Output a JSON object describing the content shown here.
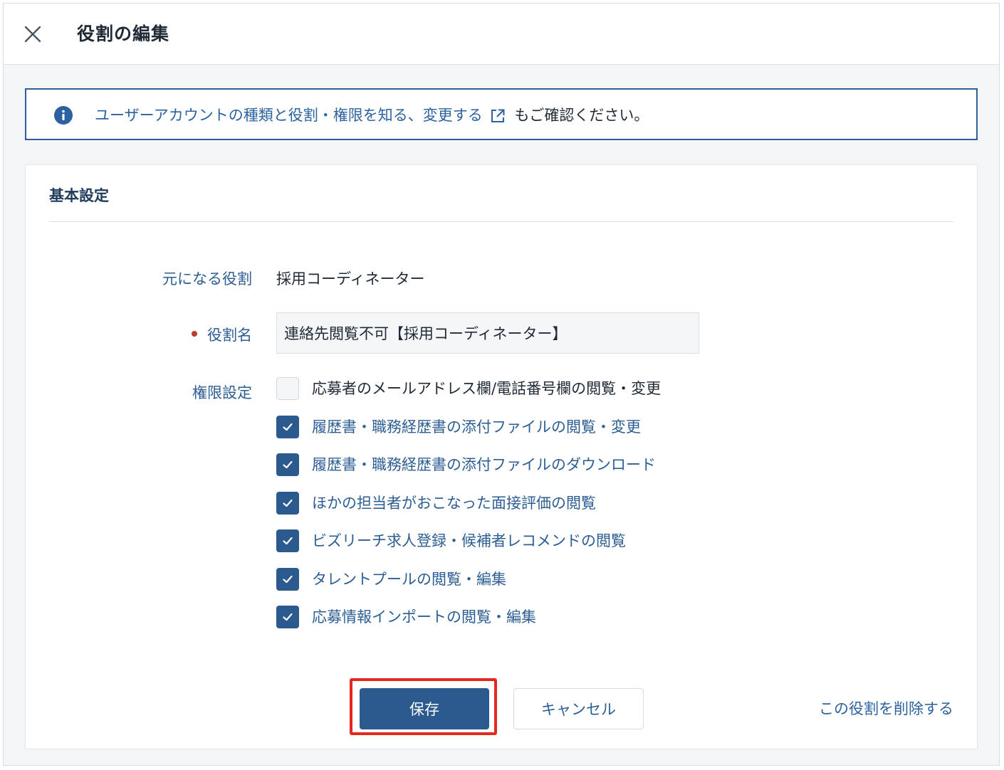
{
  "header": {
    "title": "役割の編集",
    "close_icon": "close-icon"
  },
  "notice": {
    "icon": "info-icon",
    "link_text": "ユーザーアカウントの種類と役割・権限を知る、変更する",
    "link_icon": "external-link-icon",
    "suffix_text": "もご確認ください。"
  },
  "basic_settings": {
    "section_title": "基本設定",
    "base_role_label": "元になる役割",
    "base_role_value": "採用コーディネーター",
    "role_name_label": "役割名",
    "role_name_value": "連絡先閲覧不可【採用コーディネーター】",
    "permissions_label": "権限設定",
    "permissions": [
      {
        "label": "応募者のメールアドレス欄/電話番号欄の閲覧・変更",
        "checked": false
      },
      {
        "label": "履歴書・職務経歴書の添付ファイルの閲覧・変更",
        "checked": true
      },
      {
        "label": "履歴書・職務経歴書の添付ファイルのダウンロード",
        "checked": true
      },
      {
        "label": "ほかの担当者がおこなった面接評価の閲覧",
        "checked": true
      },
      {
        "label": "ビズリーチ求人登録・候補者レコメンドの閲覧",
        "checked": true
      },
      {
        "label": "タレントプールの閲覧・編集",
        "checked": true
      },
      {
        "label": "応募情報インポートの閲覧・編集",
        "checked": true
      }
    ]
  },
  "actions": {
    "save_label": "保存",
    "cancel_label": "キャンセル",
    "delete_label": "この役割を削除する"
  },
  "colors": {
    "primary": "#2b5a8e",
    "link": "#2c62a0",
    "label": "#2c5e93",
    "required": "#c0392b",
    "highlight": "#e3291f"
  }
}
